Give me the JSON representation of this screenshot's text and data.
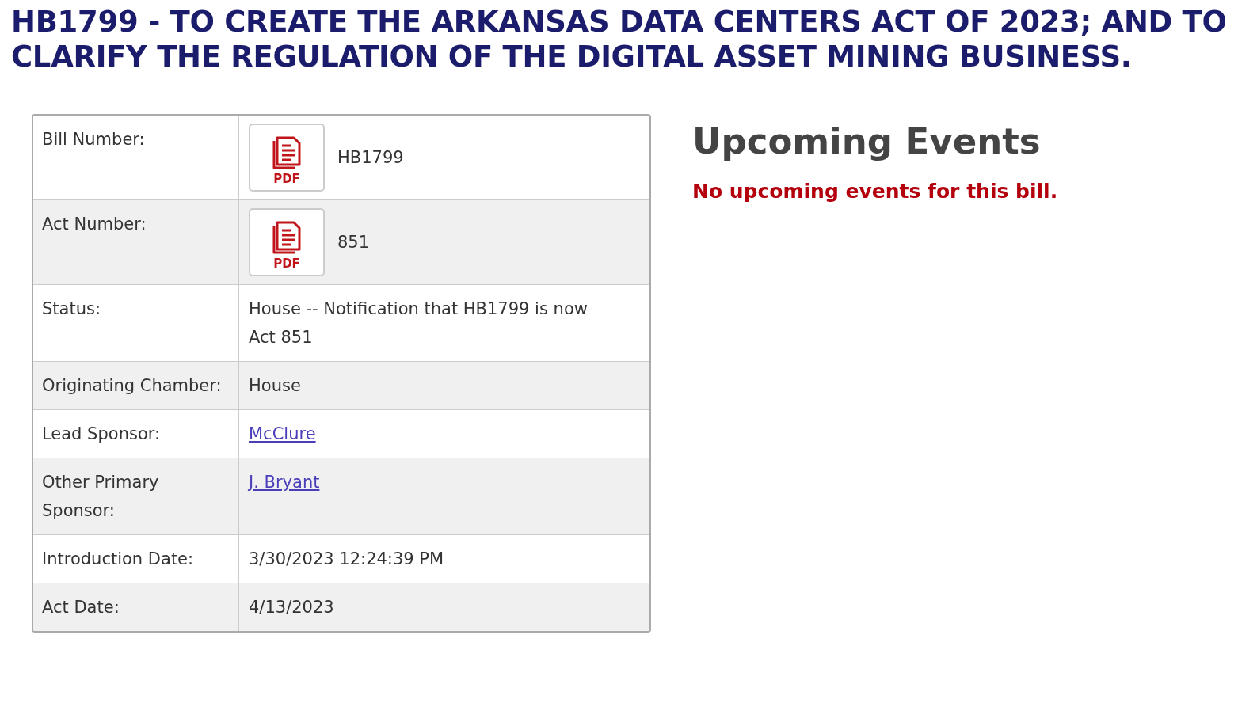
{
  "title": "HB1799 - TO CREATE THE ARKANSAS DATA CENTERS ACT OF 2023; AND TO CLARIFY THE REGULATION OF THE DIGITAL ASSET MINING BUSINESS.",
  "details": [
    {
      "label": "Bill Number:",
      "kind": "pdf",
      "pdf_label": "PDF",
      "value": "HB1799"
    },
    {
      "label": "Act Number:",
      "kind": "pdf",
      "pdf_label": "PDF",
      "value": "851"
    },
    {
      "label": "Status:",
      "kind": "text",
      "value": "House -- Notification that HB1799 is now Act 851"
    },
    {
      "label": "Originating Chamber:",
      "kind": "text",
      "value": "House"
    },
    {
      "label": "Lead Sponsor:",
      "kind": "link",
      "value": "McClure"
    },
    {
      "label": "Other Primary Sponsor:",
      "kind": "link",
      "value": "J. Bryant"
    },
    {
      "label": "Introduction Date:",
      "kind": "text",
      "value": "3/30/2023 12:24:39 PM"
    },
    {
      "label": "Act Date:",
      "kind": "text",
      "value": "4/13/2023"
    }
  ],
  "events": {
    "heading": "Upcoming Events",
    "message": "No upcoming events for this bill."
  }
}
